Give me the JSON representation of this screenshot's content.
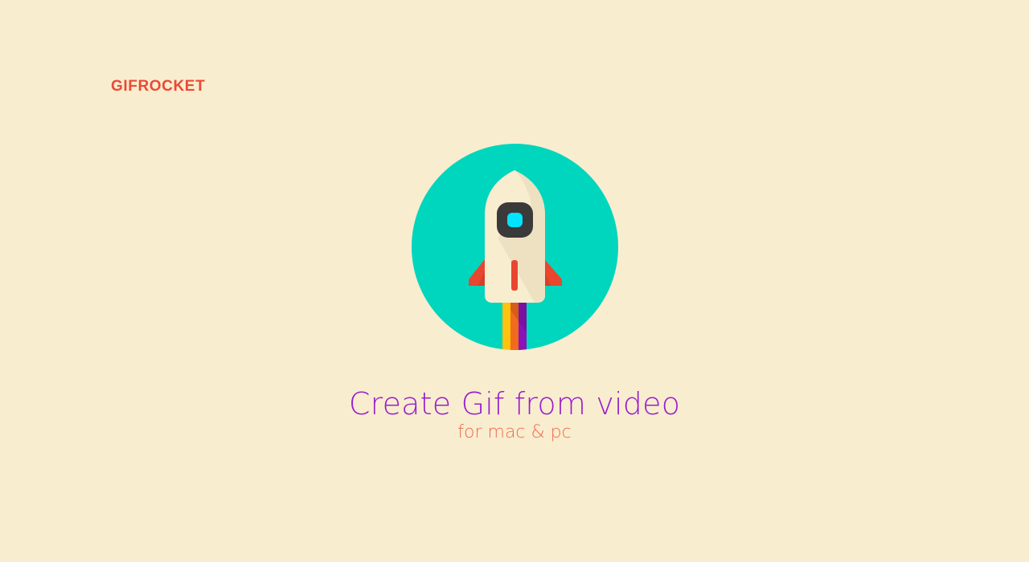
{
  "brand": {
    "name": "GIFROCKET"
  },
  "hero": {
    "logo_icon": "rocket-icon",
    "title": "Create Gif from video",
    "subtitle": "for mac & pc"
  },
  "colors": {
    "background": "#f9edcf",
    "brand": "#ea4a36",
    "circle": "#00d6bd",
    "title": "#9a1fcc",
    "subtitle": "#ef6a4f"
  }
}
